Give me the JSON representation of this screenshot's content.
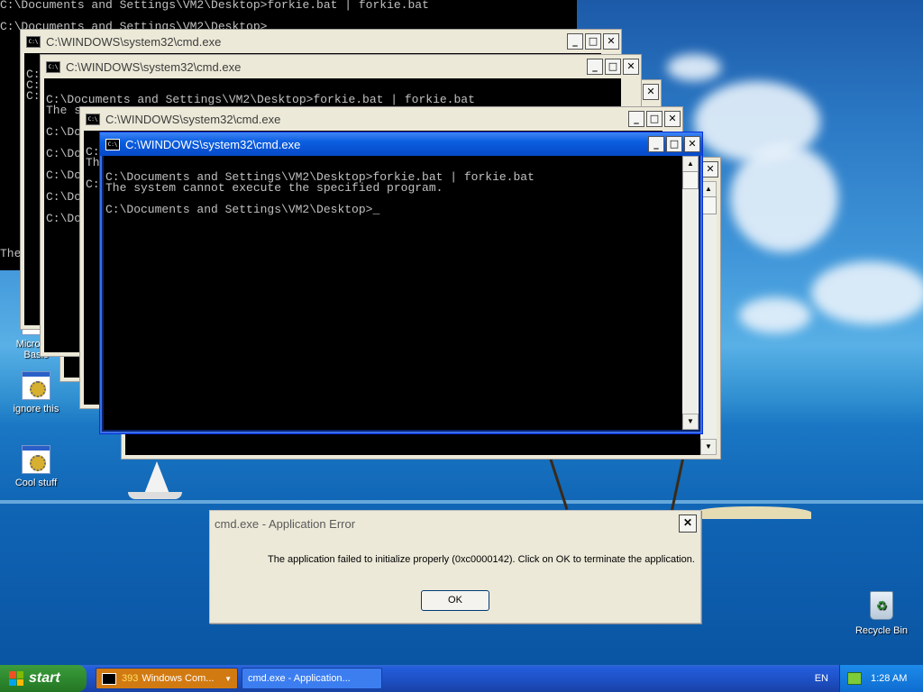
{
  "topcon": {
    "line1": "C:\\Documents and Settings\\VM2\\Desktop>forkie.bat | forkie.bat",
    "line2": "C:\\Documents and Settings\\VM2\\Desktop>",
    "left_frags": [
      "C",
      "C",
      "C",
      "C",
      "C"
    ],
    "bottom_frag": "The"
  },
  "windows": [
    {
      "title": "C:\\WINDOWS\\system32\\cmd.exe",
      "text": "\nC:\\\nC:\\\nC:\\"
    },
    {
      "title": "C:\\WINDOWS\\system32\\cmd.exe",
      "text": "\nC:\\Documents and Settings\\VM2\\Desktop>forkie.bat | forkie.bat\nThe s\n\nC:\\Do\n\nC:\\Do\n\nC:\\Do\n\nC:\\Do\n\nC:\\Do"
    },
    {
      "title": "C:\\WINDOWS\\system32\\cmd.exe",
      "text": "\nC:\\\nTh\n\nC:\\"
    },
    {
      "title": "C:\\WINDOWS\\system32\\cmd.exe",
      "text": "\nC:\\Documents and Settings\\VM2\\Desktop>forkie.bat | forkie.bat\nThe system cannot execute the specified program.\n\nC:\\Documents and Settings\\VM2\\Desktop>_"
    }
  ],
  "window_buttons": {
    "minimize": "_",
    "maximize": "□",
    "close": "✕"
  },
  "desktop_icons": [
    {
      "label": "Microsoft\nBasic",
      "icon": "app-icon"
    },
    {
      "label": "ignore this",
      "icon": "batch-file-icon"
    },
    {
      "label": "Cool stuff",
      "icon": "shortcut-icon"
    }
  ],
  "recycle_bin": {
    "label": "Recycle Bin",
    "icon": "recycle-bin-icon"
  },
  "dialog": {
    "title": "cmd.exe - Application Error",
    "message": "The application failed to initialize properly (0xc0000142). Click on OK to terminate the application.",
    "ok": "OK",
    "close": "✕"
  },
  "taskbar": {
    "start": "start",
    "group_count": "393",
    "group_label": "Windows Com...",
    "app_label": "cmd.exe - Application...",
    "lang": "EN",
    "time": "1:28 AM",
    "colors": {
      "start": "#2e8a2e",
      "task_group": "#d27a12",
      "task_app": "#3c7ef0"
    }
  }
}
